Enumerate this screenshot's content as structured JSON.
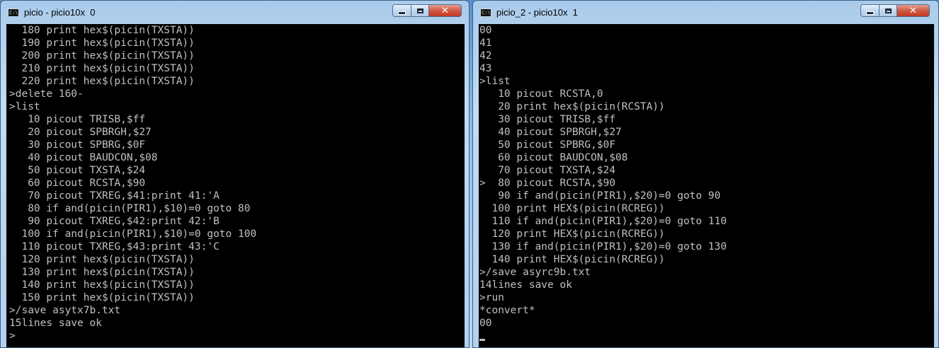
{
  "window1": {
    "title": "picio - picio10x  0",
    "icon_label": "C:\\",
    "lines": [
      "  180 print hex$(picin(TXSTA))",
      "  190 print hex$(picin(TXSTA))",
      "  200 print hex$(picin(TXSTA))",
      "  210 print hex$(picin(TXSTA))",
      "  220 print hex$(picin(TXSTA))",
      ">delete 160-",
      ">list",
      "   10 picout TRISB,$ff",
      "   20 picout SPBRGH,$27",
      "   30 picout SPBRG,$0F",
      "   40 picout BAUDCON,$08",
      "   50 picout TXSTA,$24",
      "   60 picout RCSTA,$90",
      "   70 picout TXREG,$41:print 41:'A",
      "   80 if and(picin(PIR1),$10)=0 goto 80",
      "   90 picout TXREG,$42:print 42:'B",
      "  100 if and(picin(PIR1),$10)=0 goto 100",
      "  110 picout TXREG,$43:print 43:'C",
      "  120 print hex$(picin(TXSTA))",
      "  130 print hex$(picin(TXSTA))",
      "  140 print hex$(picin(TXSTA))",
      "  150 print hex$(picin(TXSTA))",
      ">/save asytx7b.txt",
      "15lines save ok",
      ">"
    ]
  },
  "window2": {
    "title": "picio_2 - picio10x  1",
    "icon_label": "C:\\",
    "lines": [
      "00",
      "41",
      "42",
      "43",
      ">list",
      "   10 picout RCSTA,0",
      "   20 print hex$(picin(RCSTA))",
      "   30 picout TRISB,$ff",
      "   40 picout SPBRGH,$27",
      "   50 picout SPBRG,$0F",
      "   60 picout BAUDCON,$08",
      "   70 picout TXSTA,$24",
      ">  80 picout RCSTA,$90",
      "   90 if and(picin(PIR1),$20)=0 goto 90",
      "  100 print HEX$(picin(RCREG))",
      "  110 if and(picin(PIR1),$20)=0 goto 110",
      "  120 print HEX$(picin(RCREG))",
      "  130 if and(picin(PIR1),$20)=0 goto 130",
      "  140 print HEX$(picin(RCREG))",
      ">/save asyrc9b.txt",
      "14lines save ok",
      ">run",
      "*convert*",
      "00",
      ""
    ]
  },
  "controls": {
    "minimize_icon": "minimize-icon",
    "maximize_icon": "maximize-icon",
    "close_icon": "close-icon",
    "close_glyph": "✕"
  }
}
